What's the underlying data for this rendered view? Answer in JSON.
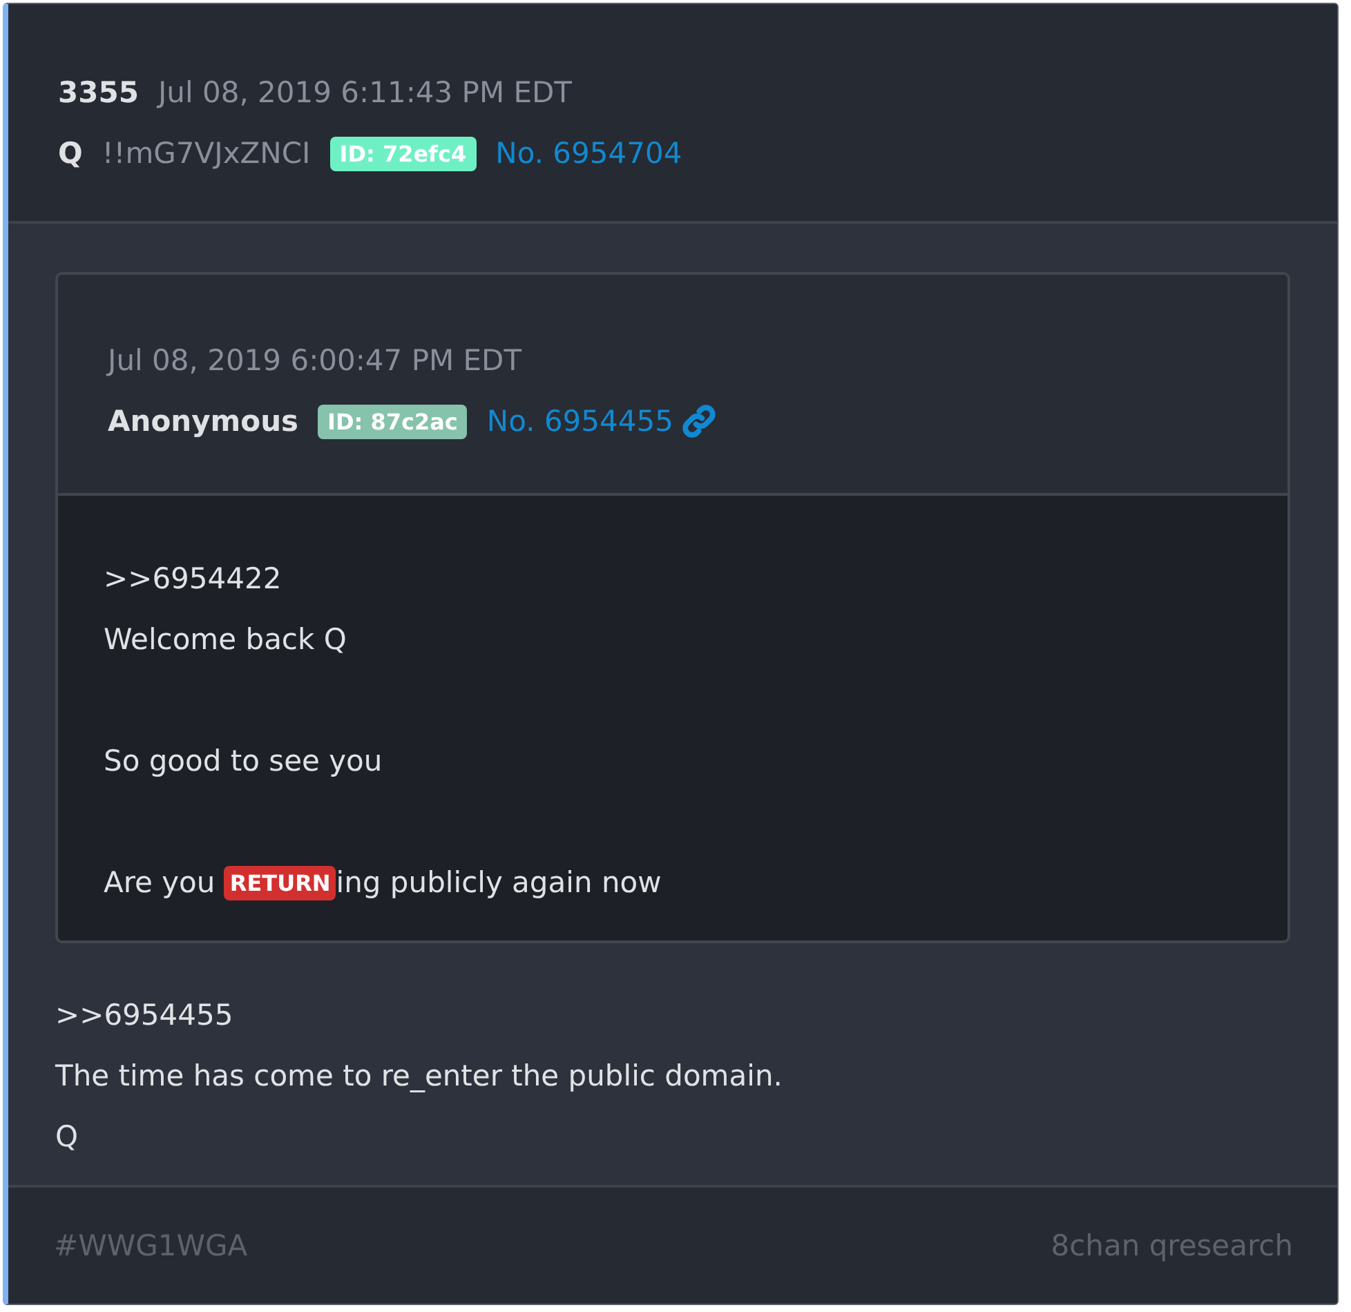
{
  "post": {
    "number": "3355",
    "timestamp": "Jul 08, 2019 6:11:43 PM EDT",
    "author": "Q",
    "tripcode": "!!mG7VJxZNCI",
    "id_badge": {
      "label": "ID: 72efc4",
      "color": "#6ff0c4"
    },
    "post_link": "No. 6954704"
  },
  "quote": {
    "timestamp": "Jul 08, 2019 6:00:47 PM EDT",
    "author": "Anonymous",
    "id_badge": {
      "label": "ID: 87c2ac",
      "color": "#86c2ac"
    },
    "post_link": "No. 6954455",
    "paragraphs": [
      [
        [
          {
            "kind": "text",
            "text": ">>6954422"
          }
        ],
        [
          {
            "kind": "text",
            "text": "Welcome back Q"
          }
        ]
      ],
      [
        [
          {
            "kind": "text",
            "text": "So good to see you"
          }
        ]
      ],
      [
        [
          {
            "kind": "text",
            "text": "Are you "
          },
          {
            "kind": "highlight",
            "text": "RETURN"
          },
          {
            "kind": "text",
            "text": "ing publicly again now"
          }
        ]
      ]
    ]
  },
  "body": [
    ">>6954455",
    "The time has come to re_enter the public domain.",
    "Q"
  ],
  "footer": {
    "hashtag": "#WWG1WGA",
    "source": "8chan qresearch"
  }
}
